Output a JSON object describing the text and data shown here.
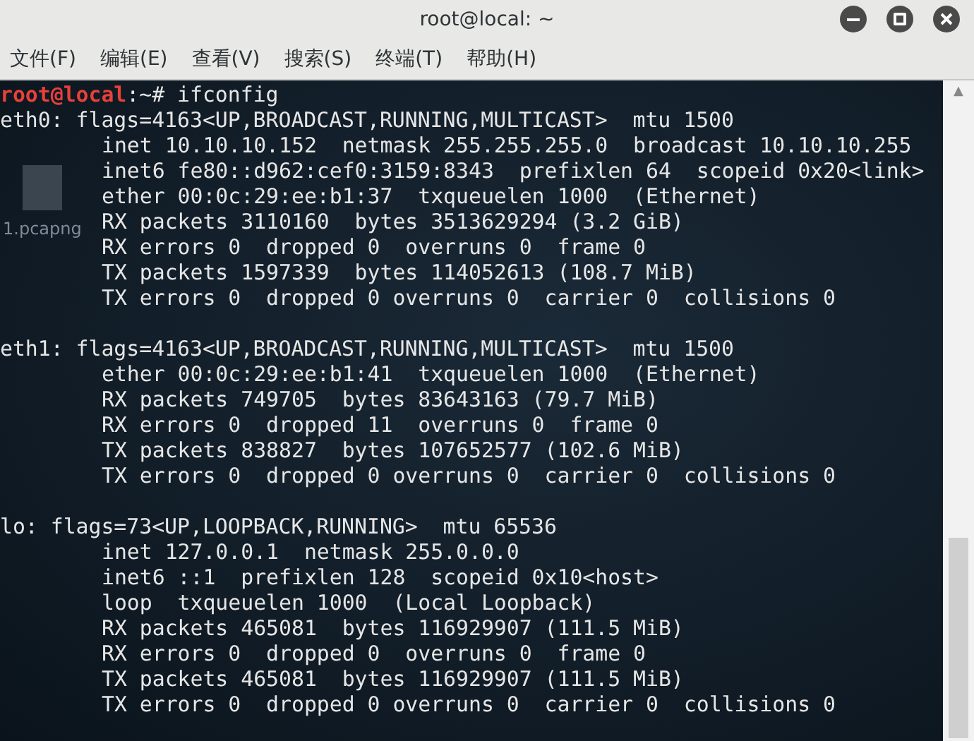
{
  "window": {
    "title": "root@local: ~"
  },
  "menu": [
    "文件(F)",
    "编辑(E)",
    "查看(V)",
    "搜索(S)",
    "终端(T)",
    "帮助(H)"
  ],
  "desktop_file": {
    "label": "1.pcapng"
  },
  "terminal": {
    "prompt": {
      "user_host": "root@local",
      "path": ":~#",
      "command": " ifconfig"
    },
    "scroll_up": "▲",
    "blocks": [
      [
        {
          "kind": "header",
          "text": "eth0: flags=4163<UP,BROADCAST,RUNNING,MULTICAST>  mtu 1500"
        },
        {
          "kind": "detail",
          "text": "inet 10.10.10.152  netmask 255.255.255.0  broadcast 10.10.10.255"
        },
        {
          "kind": "detail",
          "text": "inet6 fe80::d962:cef0:3159:8343  prefixlen 64  scopeid 0x20<link>"
        },
        {
          "kind": "detail",
          "text": "ether 00:0c:29:ee:b1:37  txqueuelen 1000  (Ethernet)"
        },
        {
          "kind": "detail",
          "text": "RX packets 3110160  bytes 3513629294 (3.2 GiB)"
        },
        {
          "kind": "detail",
          "text": "RX errors 0  dropped 0  overruns 0  frame 0"
        },
        {
          "kind": "detail",
          "text": "TX packets 1597339  bytes 114052613 (108.7 MiB)"
        },
        {
          "kind": "detail",
          "text": "TX errors 0  dropped 0 overruns 0  carrier 0  collisions 0"
        }
      ],
      [
        {
          "kind": "header",
          "text": "eth1: flags=4163<UP,BROADCAST,RUNNING,MULTICAST>  mtu 1500"
        },
        {
          "kind": "detail",
          "text": "ether 00:0c:29:ee:b1:41  txqueuelen 1000  (Ethernet)"
        },
        {
          "kind": "detail",
          "text": "RX packets 749705  bytes 83643163 (79.7 MiB)"
        },
        {
          "kind": "detail",
          "text": "RX errors 0  dropped 11  overruns 0  frame 0"
        },
        {
          "kind": "detail",
          "text": "TX packets 838827  bytes 107652577 (102.6 MiB)"
        },
        {
          "kind": "detail",
          "text": "TX errors 0  dropped 0 overruns 0  carrier 0  collisions 0"
        }
      ],
      [
        {
          "kind": "header",
          "text": "lo: flags=73<UP,LOOPBACK,RUNNING>  mtu 65536"
        },
        {
          "kind": "detail",
          "text": "inet 127.0.0.1  netmask 255.0.0.0"
        },
        {
          "kind": "detail",
          "text": "inet6 ::1  prefixlen 128  scopeid 0x10<host>"
        },
        {
          "kind": "detail",
          "text": "loop  txqueuelen 1000  (Local Loopback)"
        },
        {
          "kind": "detail",
          "text": "RX packets 465081  bytes 116929907 (111.5 MiB)"
        },
        {
          "kind": "detail",
          "text": "RX errors 0  dropped 0  overruns 0  frame 0"
        },
        {
          "kind": "detail",
          "text": "TX packets 465081  bytes 116929907 (111.5 MiB)"
        },
        {
          "kind": "detail",
          "text": "TX errors 0  dropped 0 overruns 0  carrier 0  collisions 0"
        }
      ]
    ]
  }
}
